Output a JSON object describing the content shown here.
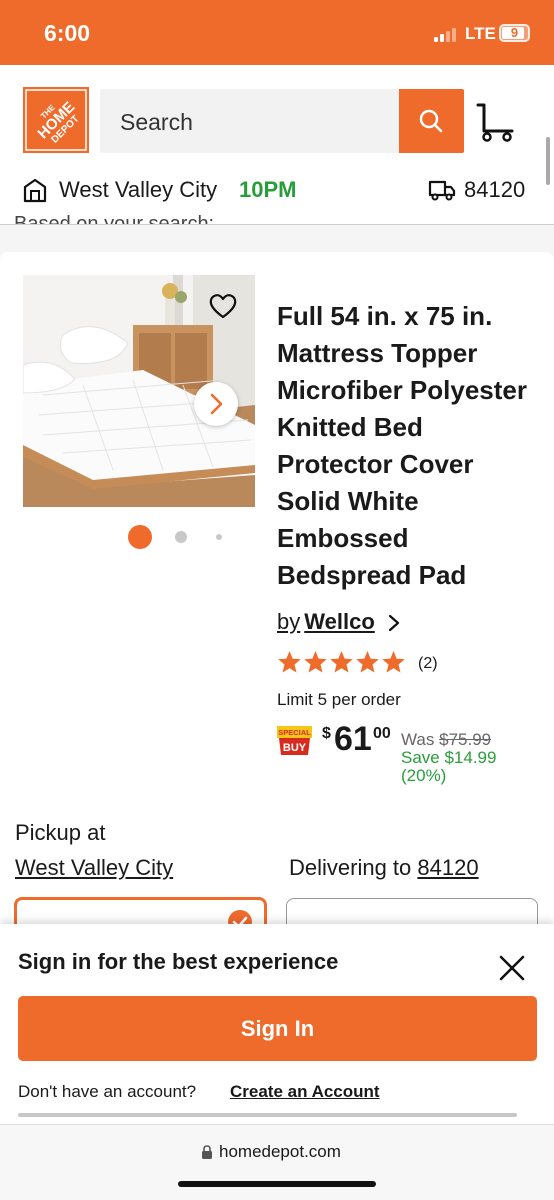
{
  "status_bar": {
    "time": "6:00",
    "network": "LTE",
    "battery": "9"
  },
  "header": {
    "logo_text": "THE HOME DEPOT",
    "search_placeholder": "Search",
    "store_name": "West Valley City",
    "store_hours": "10PM",
    "delivery_zip": "84120"
  },
  "search_context_text": "Based on your search:",
  "product": {
    "title": "Full 54 in. x 75 in. Mattress Topper Microfiber Polyester Knitted Bed Protector Cover Solid White Embossed Bedspread Pad",
    "brand_prefix": "by",
    "brand": "Wellco",
    "rating": 5,
    "review_count": "(2)",
    "limit": "Limit 5 per order",
    "badge_line1": "SPECIAL",
    "badge_line2": "BUY",
    "price_symbol": "$",
    "price_dollars": "61",
    "price_cents": "00",
    "was_label": "Was",
    "was_price": "$75.99",
    "save_text": "Save $14.99",
    "save_percent": "(20%)",
    "image_count": 3,
    "active_image": 1
  },
  "fulfillment": {
    "pickup_label": "Pickup at",
    "pickup_store": "West Valley City",
    "delivering_label": "Delivering to",
    "delivering_zip": "84120"
  },
  "sign_in_sheet": {
    "title": "Sign in for the best experience",
    "sign_in_button": "Sign In",
    "no_account_text": "Don't have an account?",
    "create_account_link": "Create an Account"
  },
  "browser": {
    "url": "homedepot.com"
  },
  "colors": {
    "brand_orange": "#ee6b2c",
    "success_green": "#2a9d3b",
    "special_buy_red": "#d62b1f"
  },
  "icons": {
    "search": "search-icon",
    "cart": "cart-icon",
    "store": "store-icon",
    "delivery": "truck-icon",
    "favorite": "heart-icon",
    "next_image": "chevron-right-icon",
    "close": "close-icon",
    "lock": "lock-icon"
  }
}
